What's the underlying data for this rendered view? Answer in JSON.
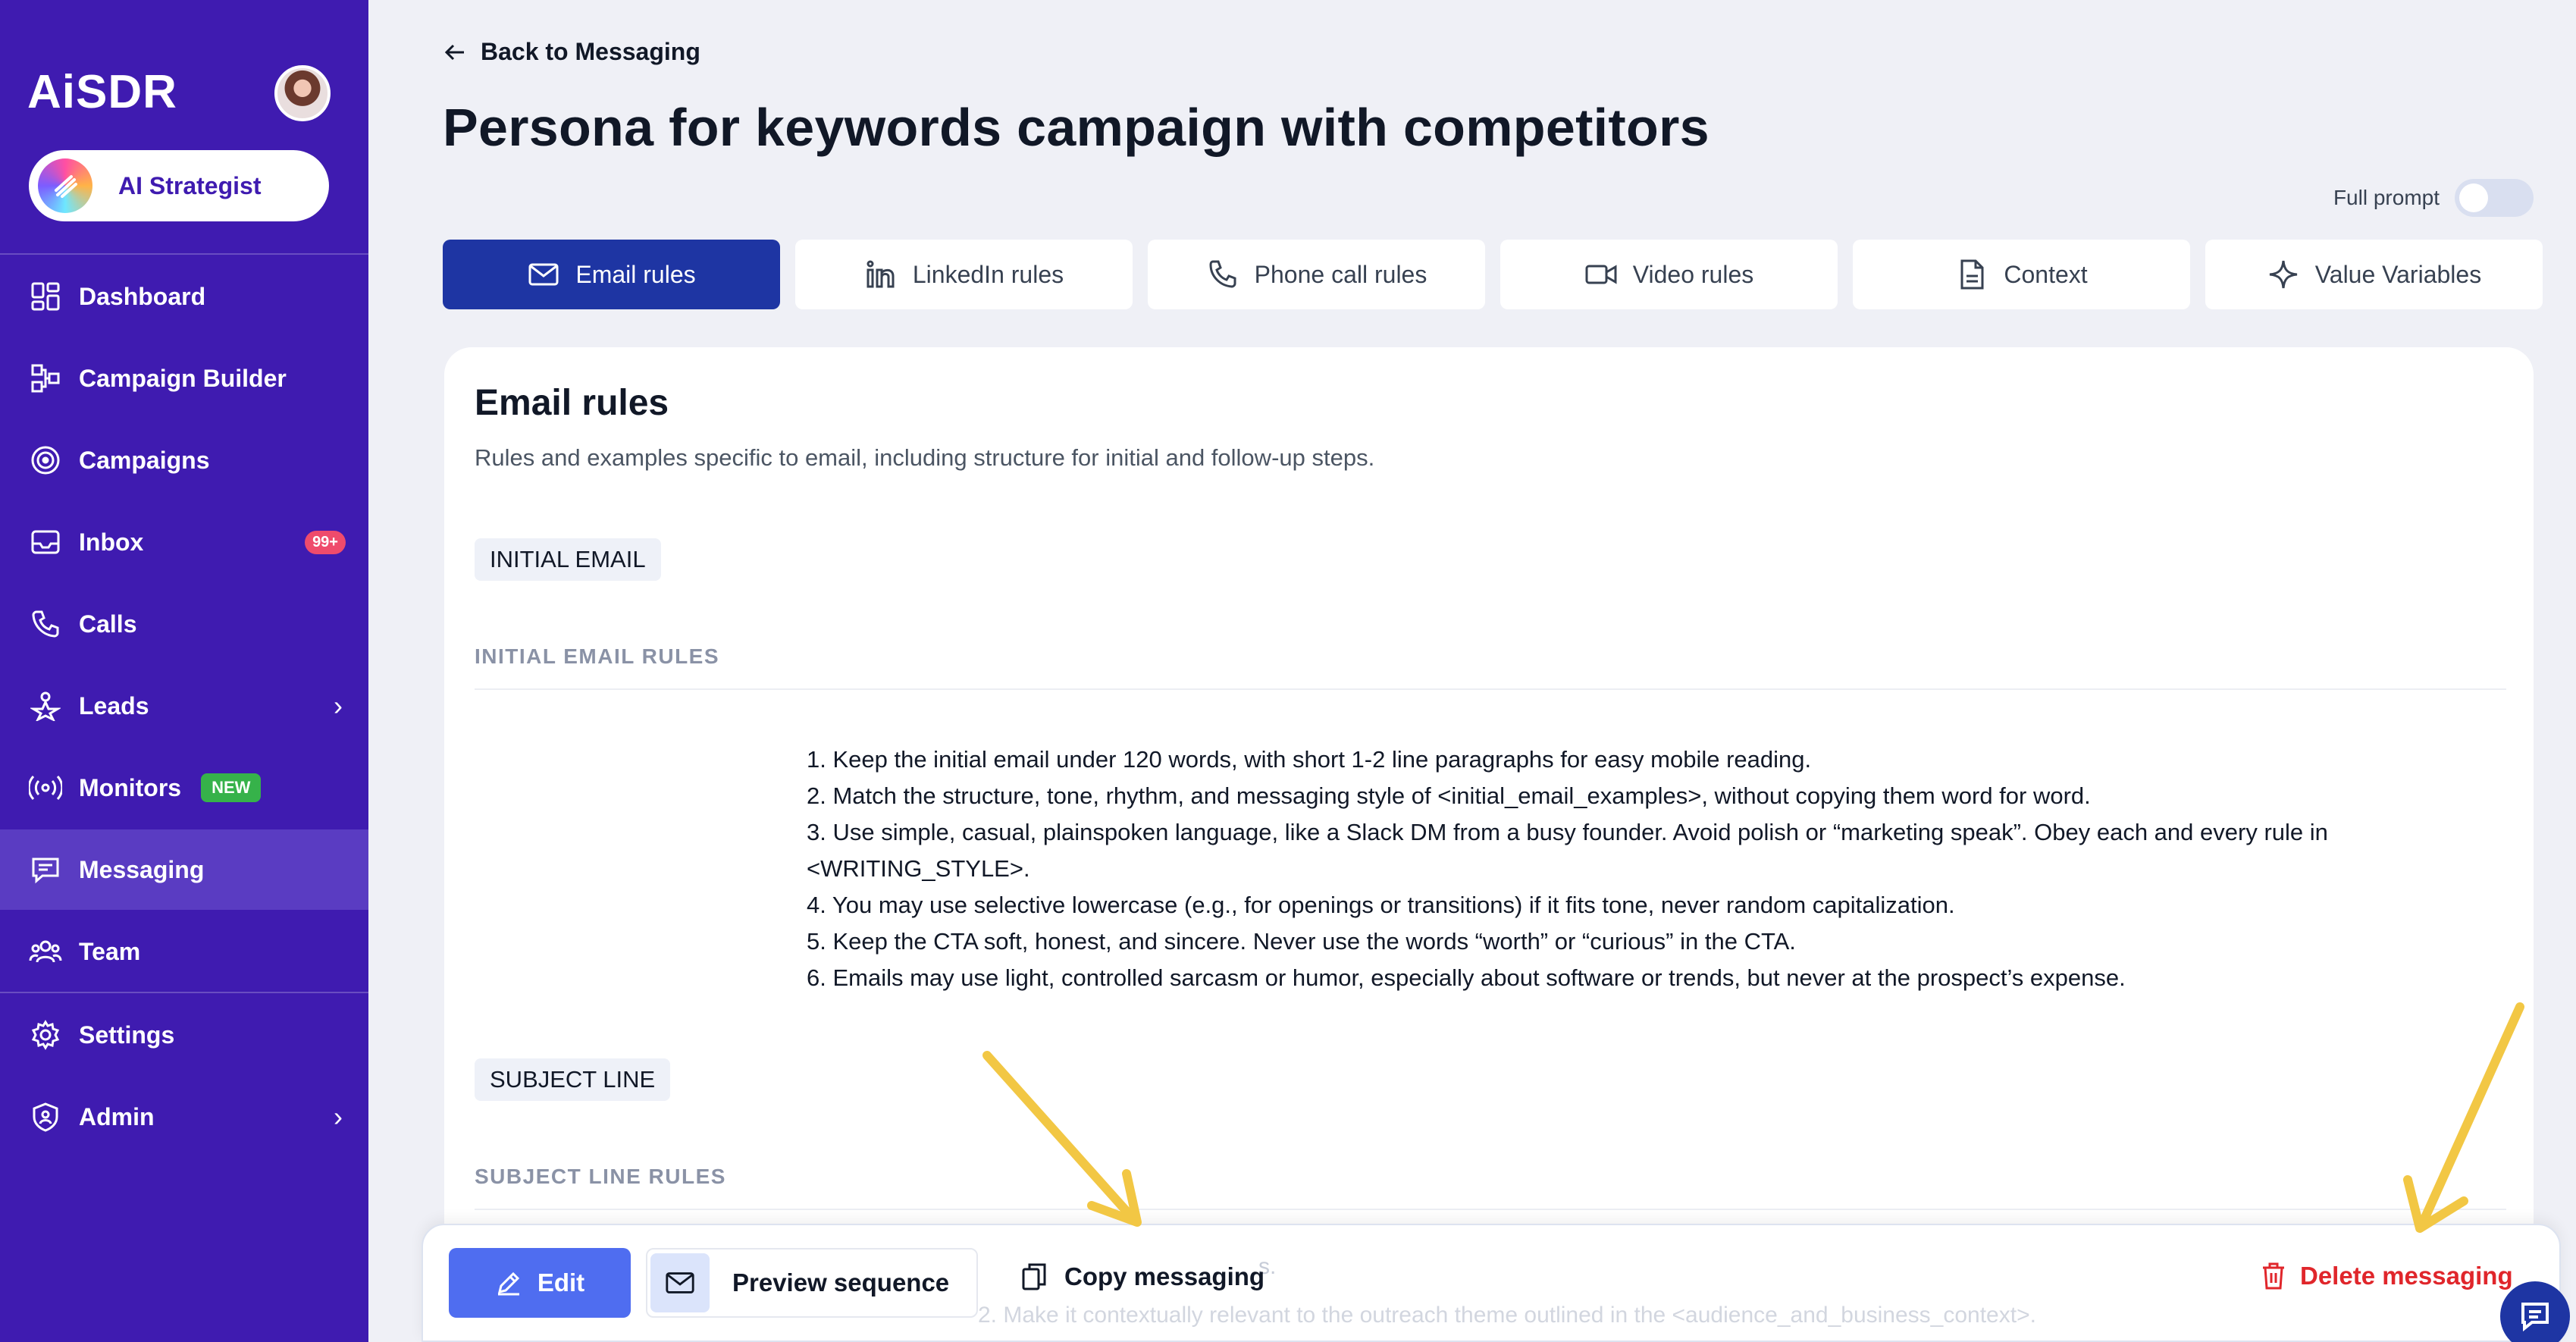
{
  "sidebar": {
    "logo": "AiSDR",
    "strategist_label": "AI Strategist",
    "items": [
      {
        "label": "Dashboard"
      },
      {
        "label": "Campaign Builder"
      },
      {
        "label": "Campaigns"
      },
      {
        "label": "Inbox",
        "badge": "99+"
      },
      {
        "label": "Calls"
      },
      {
        "label": "Leads"
      },
      {
        "label": "Monitors",
        "badge": "NEW"
      },
      {
        "label": "Messaging"
      },
      {
        "label": "Team"
      },
      {
        "label": "Settings"
      },
      {
        "label": "Admin"
      }
    ],
    "active_item": "Messaging",
    "background": "#3f1bb0"
  },
  "header": {
    "back_label": "Back to Messaging",
    "title": "Persona for keywords campaign with competitors",
    "full_prompt_label": "Full prompt"
  },
  "tabs": [
    {
      "label": "Email rules",
      "icon": "mail-icon"
    },
    {
      "label": "LinkedIn rules",
      "icon": "linkedin-icon"
    },
    {
      "label": "Phone call rules",
      "icon": "phone-icon"
    },
    {
      "label": "Video rules",
      "icon": "video-icon"
    },
    {
      "label": "Context",
      "icon": "document-icon"
    },
    {
      "label": "Value Variables",
      "icon": "sparkle-icon"
    }
  ],
  "content": {
    "title": "Email rules",
    "subtitle": "Rules and examples specific to email, including structure for initial and follow-up steps.",
    "initial_chip": "INITIAL EMAIL",
    "initial_rules_heading": "INITIAL EMAIL RULES",
    "rules": [
      "1. Keep the initial email under 120 words, with short 1-2 line paragraphs for easy mobile reading.",
      "2. Match the structure, tone, rhythm, and messaging style of <initial_email_examples>, without copying them word for word.",
      "3. Use simple, casual, plainspoken language, like a Slack DM from a busy founder. Avoid polish or “marketing speak”. Obey each and every rule in <WRITING_STYLE>.",
      "4. You may use selective lowercase (e.g., for openings or transitions) if it fits tone, never random capitalization.",
      "5. Keep the CTA soft, honest, and sincere. Never use the words “worth” or “curious” in the CTA.",
      "6. Emails may use light, controlled sarcasm or humor, especially about software or trends, but never at the prospect’s expense."
    ],
    "subject_chip": "SUBJECT LINE",
    "subject_rules_heading": "SUBJECT LINE RULES",
    "faded_line_1": "s.",
    "faded_line_2": "2. Make it contextually relevant to the outreach theme outlined in the <audience_and_business_context>."
  },
  "toolbar": {
    "edit_label": "Edit",
    "preview_label": "Preview sequence",
    "copy_label": "Copy messaging",
    "delete_label": "Delete messaging"
  },
  "colors": {
    "accent": "#1e35a3",
    "edit_button": "#4f6df0",
    "delete": "#e0262b",
    "annotation_arrow": "#f2c744"
  }
}
